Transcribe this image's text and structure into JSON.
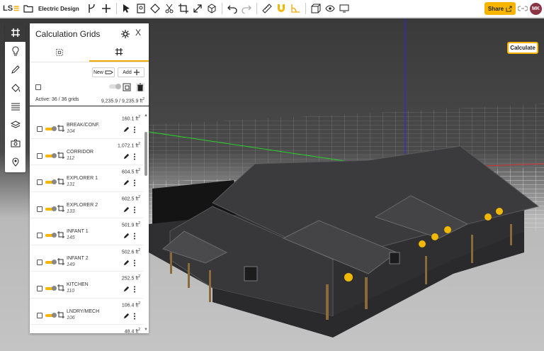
{
  "app": {
    "logo": "LS",
    "project_name": "Electric Design"
  },
  "toolbar": {
    "share_label": "Share",
    "user_initials": "MK"
  },
  "viewport": {
    "calculate_label": "Calculate"
  },
  "panel": {
    "title": "Calculation Grids",
    "new_label": "New",
    "add_label": "Add",
    "active_summary": "Active: 36 / 36 grids",
    "area_summary": "9,235.9 / 9,235.9 ft",
    "area_unit_sup": "2",
    "rows": [
      {
        "name": "BREAK/CONF.",
        "number": "104",
        "area": "160.1 ft"
      },
      {
        "name": "CORRIDOR",
        "number": "112",
        "area": "1,072.1 ft"
      },
      {
        "name": "EXPLORER 1",
        "number": "131",
        "area": "604.5 ft"
      },
      {
        "name": "EXPLORER 2",
        "number": "133",
        "area": "602.5 ft"
      },
      {
        "name": "INFANT 1",
        "number": "145",
        "area": "501.9 ft"
      },
      {
        "name": "INFANT 2",
        "number": "149",
        "area": "502.6 ft"
      },
      {
        "name": "KITCHEN",
        "number": "110",
        "area": "252.5 ft"
      },
      {
        "name": "LNDRY/MECH",
        "number": "106",
        "area": "106.4 ft"
      }
    ],
    "last_area": "48.4 ft"
  },
  "colors": {
    "accent": "#f7b500",
    "avatar": "#8c3344",
    "roof": "#3b3b3d"
  }
}
